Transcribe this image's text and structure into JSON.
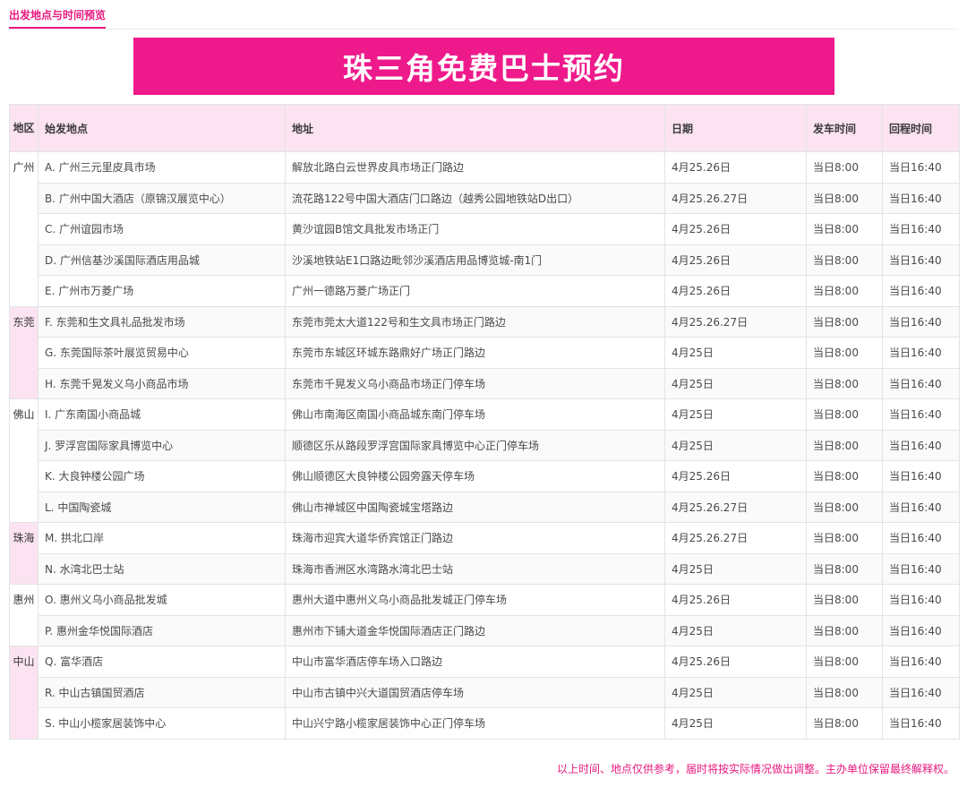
{
  "tab": {
    "label": "出发地点与时间预览"
  },
  "banner": {
    "title": "珠三角免费巴士预约"
  },
  "table": {
    "headers": {
      "region": "地区",
      "origin": "始发地点",
      "address": "地址",
      "date": "日期",
      "depart": "发车时间",
      "return": "回程时间"
    },
    "regions": [
      {
        "name": "广州",
        "rows": [
          {
            "origin": "A. 广州三元里皮具市场",
            "address": "解放北路白云世界皮具市场正门路边",
            "date": "4月25.26日",
            "depart": "当日8:00",
            "return": "当日16:40"
          },
          {
            "origin": "B. 广州中国大酒店（原锦汉展览中心）",
            "address": "流花路122号中国大酒店门口路边（越秀公园地铁站D出口）",
            "date": "4月25.26.27日",
            "depart": "当日8:00",
            "return": "当日16:40"
          },
          {
            "origin": "C. 广州谊园市场",
            "address": "黄沙谊园B馆文具批发市场正门",
            "date": "4月25.26日",
            "depart": "当日8:00",
            "return": "当日16:40"
          },
          {
            "origin": "D. 广州信基沙溪国际酒店用品城",
            "address": "沙溪地铁站E1口路边毗邻沙溪酒店用品博览城-南1门",
            "date": "4月25.26日",
            "depart": "当日8:00",
            "return": "当日16:40"
          },
          {
            "origin": "E. 广州市万菱广场",
            "address": "广州一德路万菱广场正门",
            "date": "4月25.26日",
            "depart": "当日8:00",
            "return": "当日16:40"
          }
        ]
      },
      {
        "name": "东莞",
        "rows": [
          {
            "origin": "F. 东莞和生文具礼品批发市场",
            "address": "东莞市莞太大道122号和生文具市场正门路边",
            "date": "4月25.26.27日",
            "depart": "当日8:00",
            "return": "当日16:40"
          },
          {
            "origin": "G. 东莞国际茶叶展览贸易中心",
            "address": "东莞市东城区环城东路鼎好广场正门路边",
            "date": "4月25日",
            "depart": "当日8:00",
            "return": "当日16:40"
          },
          {
            "origin": "H. 东莞千晃发义乌小商品市场",
            "address": "东莞市千晃发义乌小商品市场正门停车场",
            "date": "4月25日",
            "depart": "当日8:00",
            "return": "当日16:40"
          }
        ]
      },
      {
        "name": "佛山",
        "rows": [
          {
            "origin": "I. 广东南国小商品城",
            "address": "佛山市南海区南国小商品城东南门停车场",
            "date": "4月25日",
            "depart": "当日8:00",
            "return": "当日16:40"
          },
          {
            "origin": "J. 罗浮宫国际家具博览中心",
            "address": "顺德区乐从路段罗浮宫国际家具博览中心正门停车场",
            "date": "4月25日",
            "depart": "当日8:00",
            "return": "当日16:40"
          },
          {
            "origin": "K. 大良钟楼公园广场",
            "address": "佛山顺德区大良钟楼公园旁露天停车场",
            "date": "4月25.26日",
            "depart": "当日8:00",
            "return": "当日16:40"
          },
          {
            "origin": "L. 中国陶瓷城",
            "address": "佛山市禅城区中国陶瓷城宝塔路边",
            "date": "4月25.26.27日",
            "depart": "当日8:00",
            "return": "当日16:40"
          }
        ]
      },
      {
        "name": "珠海",
        "rows": [
          {
            "origin": "M. 拱北口岸",
            "address": "珠海市迎宾大道华侨宾馆正门路边",
            "date": "4月25.26.27日",
            "depart": "当日8:00",
            "return": "当日16:40"
          },
          {
            "origin": "N. 水湾北巴士站",
            "address": "珠海市香洲区水湾路水湾北巴士站",
            "date": "4月25日",
            "depart": "当日8:00",
            "return": "当日16:40"
          }
        ]
      },
      {
        "name": "惠州",
        "rows": [
          {
            "origin": "O. 惠州义乌小商品批发城",
            "address": "惠州大道中惠州义乌小商品批发城正门停车场",
            "date": "4月25.26日",
            "depart": "当日8:00",
            "return": "当日16:40"
          },
          {
            "origin": "P. 惠州金华悦国际酒店",
            "address": "惠州市下铺大道金华悦国际酒店正门路边",
            "date": "4月25日",
            "depart": "当日8:00",
            "return": "当日16:40"
          }
        ]
      },
      {
        "name": "中山",
        "rows": [
          {
            "origin": "Q. 富华酒店",
            "address": "中山市富华酒店停车场入口路边",
            "date": "4月25.26日",
            "depart": "当日8:00",
            "return": "当日16:40"
          },
          {
            "origin": "R. 中山古镇国贸酒店",
            "address": "中山市古镇中兴大道国贸酒店停车场",
            "date": "4月25日",
            "depart": "当日8:00",
            "return": "当日16:40"
          },
          {
            "origin": "S. 中山小榄家居装饰中心",
            "address": "中山兴宁路小榄家居装饰中心正门停车场",
            "date": "4月25日",
            "depart": "当日8:00",
            "return": "当日16:40"
          }
        ]
      }
    ]
  },
  "footer": {
    "note": "以上时间、地点仅供参考，届时将按实际情况做出调整。主办单位保留最终解释权。"
  },
  "colors": {
    "accent": "#e8197f",
    "banner": "#ee1a8c",
    "header_bg": "#fbe3f1"
  }
}
